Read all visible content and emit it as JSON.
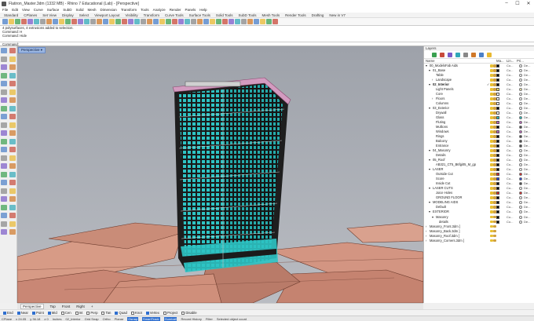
{
  "window": {
    "title": "Flatiron_Master.3dm (1332 MB) - Rhino 7 Educational (Lab) - [Perspective]",
    "controls": [
      "–",
      "☐",
      "✕"
    ]
  },
  "menubar": [
    "File",
    "Edit",
    "View",
    "Curve",
    "Surface",
    "SubD",
    "Solid",
    "Mesh",
    "Dimension",
    "Transform",
    "Tools",
    "Analyze",
    "Render",
    "Panels",
    "Help"
  ],
  "toolbar_tabs": [
    "Standard",
    "CPlanes",
    "Set View",
    "Display",
    "Select",
    "Viewport Layout",
    "Visibility",
    "Transform",
    "Curve Tools",
    "Surface Tools",
    "Solid Tools",
    "SubD Tools",
    "Mesh Tools",
    "Render Tools",
    "Drafting",
    "New in V7"
  ],
  "command_history": [
    "4 polysurfaces, 4 extrusions added to selection.",
    "Command: H",
    "Command: Hide"
  ],
  "command_prompt": "Command:",
  "viewport": {
    "label": "Perspective ▾"
  },
  "viewport_tabs": [
    "Perspective",
    "Top",
    "Front",
    "Right",
    "+"
  ],
  "layers_panel": {
    "header": "Layers",
    "columns": [
      "Name",
      "Ma...",
      "Lin...",
      "Pri..."
    ],
    "rows": [
      {
        "name": "00_ModelsFab Aids",
        "indent": 0,
        "expand": "▾",
        "color": "#000000",
        "mat": "Co...",
        "pri": "De...",
        "mat_color": "#ffffff"
      },
      {
        "name": "01_Base",
        "indent": 1,
        "expand": "▾",
        "color": "#000000",
        "mat": "Co...",
        "pri": "De...",
        "mat_color": "#ffffff"
      },
      {
        "name": "Table",
        "indent": 2,
        "expand": "",
        "color": "#000000",
        "mat": "Co...",
        "pri": "De...",
        "mat_color": "#ffffff"
      },
      {
        "name": "Landscape",
        "indent": 2,
        "expand": "›",
        "color": "#000000",
        "mat": "Co...",
        "pri": "De...",
        "mat_color": "#ffffff"
      },
      {
        "name": "02_Interior",
        "indent": 1,
        "expand": "▾",
        "color": "#000000",
        "mat": "Co...",
        "pri": "De...",
        "mat_color": "#ffffff",
        "check": "✓",
        "bold": true
      },
      {
        "name": "Light Panels",
        "indent": 2,
        "expand": "",
        "color": "#f0e060",
        "mat": "Co...",
        "pri": "De...",
        "mat_color": "#f7efb0"
      },
      {
        "name": "Core",
        "indent": 2,
        "expand": "",
        "color": "#ffffff",
        "mat": "Co...",
        "pri": "De...",
        "mat_color": "#ffffff"
      },
      {
        "name": "Floors",
        "indent": 2,
        "expand": "›",
        "color": "#ffffff",
        "mat": "Co...",
        "pri": "De...",
        "mat_color": "#ffffff"
      },
      {
        "name": "Columns",
        "indent": 2,
        "expand": "",
        "color": "#ffffff",
        "mat": "Co...",
        "pri": "De...",
        "mat_color": "#ffffff"
      },
      {
        "name": "03_Exterior",
        "indent": 1,
        "expand": "▾",
        "color": "#000000",
        "mat": "Co...",
        "pri": "De...",
        "mat_color": "#ffffff"
      },
      {
        "name": "Drywall",
        "indent": 2,
        "expand": "",
        "color": "#ffffff",
        "mat": "Co...",
        "pri": "De...",
        "mat_color": "#ffffff"
      },
      {
        "name": "Glass",
        "indent": 2,
        "expand": "",
        "color": "#20c0c0",
        "mat": "Co...",
        "pri": "De...",
        "mat_color": "#20c0c0"
      },
      {
        "name": "Fluting",
        "indent": 2,
        "expand": "",
        "color": "#c060c0",
        "mat": "Co...",
        "pri": "De...",
        "mat_color": "#c060c0"
      },
      {
        "name": "Mullions",
        "indent": 2,
        "expand": "",
        "color": "#000000",
        "mat": "Co...",
        "pri": "De...",
        "mat_color": "#444444"
      },
      {
        "name": "Windows",
        "indent": 2,
        "expand": "",
        "color": "#c060c0",
        "mat": "Co...",
        "pri": "De...",
        "mat_color": "#c060c0"
      },
      {
        "name": "Rings",
        "indent": 2,
        "expand": "",
        "color": "#000000",
        "mat": "Co...",
        "pri": "De...",
        "mat_color": "#444444"
      },
      {
        "name": "Balcony",
        "indent": 2,
        "expand": "",
        "color": "#000000",
        "mat": "Co...",
        "pri": "De...",
        "mat_color": "#444444"
      },
      {
        "name": "Entrance",
        "indent": 2,
        "expand": "",
        "color": "#000000",
        "mat": "Co...",
        "pri": "De...",
        "mat_color": "#444444"
      },
      {
        "name": "04_Masonry",
        "indent": 1,
        "expand": "▾",
        "color": "#000000",
        "mat": "Co...",
        "pri": "De...",
        "mat_color": "#ffffff"
      },
      {
        "name": "Details",
        "indent": 2,
        "expand": "",
        "color": "#000000",
        "mat": "Co...",
        "pri": "De...",
        "mat_color": "#ffffff"
      },
      {
        "name": "05_Roof",
        "indent": 1,
        "expand": "▾",
        "color": "#000000",
        "mat": "Co...",
        "pri": "De...",
        "mat_color": "#ffffff"
      },
      {
        "name": "AB321_CT5_B6fgi05_M_gp",
        "indent": 2,
        "expand": "",
        "color": "#000000",
        "mat": "Co...",
        "pri": "De...",
        "mat_color": "#ffffff"
      },
      {
        "name": "LASER",
        "indent": 1,
        "expand": "▾",
        "color": "#000000",
        "mat": "Co...",
        "pri": "De...",
        "mat_color": "#ffffff"
      },
      {
        "name": "Outside Cut",
        "indent": 2,
        "expand": "",
        "color": "#e02020",
        "mat": "Co...",
        "pri": "De...",
        "mat_color": "#e02020"
      },
      {
        "name": "Score",
        "indent": 2,
        "expand": "",
        "color": "#2040e0",
        "mat": "Co...",
        "pri": "De...",
        "mat_color": "#2040e0"
      },
      {
        "name": "Inside Cut",
        "indent": 2,
        "expand": "",
        "color": "#000000",
        "mat": "Co...",
        "pri": "De...",
        "mat_color": "#444444"
      },
      {
        "name": "LASER CUTS",
        "indent": 1,
        "expand": "▾",
        "color": "#000000",
        "mat": "Co...",
        "pri": "De...",
        "mat_color": "#ffffff"
      },
      {
        "name": "Joice Holes",
        "indent": 2,
        "expand": "",
        "color": "#e02020",
        "mat": "Co...",
        "pri": "De...",
        "mat_color": "#e02020"
      },
      {
        "name": "GROUND FLOOR",
        "indent": 2,
        "expand": "",
        "color": "#000000",
        "mat": "Co...",
        "pri": "De...",
        "mat_color": "#ffffff"
      },
      {
        "name": "MODELING AIDS",
        "indent": 1,
        "expand": "▾",
        "color": "#000000",
        "mat": "Co...",
        "pri": "De...",
        "mat_color": "#ffffff"
      },
      {
        "name": "Default",
        "indent": 2,
        "expand": "",
        "color": "#000000",
        "mat": "Co...",
        "pri": "De...",
        "mat_color": "#ffffff"
      },
      {
        "name": "EXTERIOR",
        "indent": 1,
        "expand": "▾",
        "color": "#000000",
        "mat": "Co...",
        "pri": "De...",
        "mat_color": "#ffffff"
      },
      {
        "name": "Masonry",
        "indent": 2,
        "expand": "▾",
        "color": "#000000",
        "mat": "Co...",
        "pri": "De...",
        "mat_color": "#ffffff"
      },
      {
        "name": "details",
        "indent": 3,
        "expand": "",
        "color": "#000000",
        "mat": "Co...",
        "pri": "De...",
        "mat_color": "#ffffff"
      },
      {
        "name": "Masonry_Front.3dm ]",
        "indent": 0,
        "expand": "›",
        "color": "",
        "mat": "",
        "pri": "",
        "mat_color": ""
      },
      {
        "name": "Masonry_Back.3dm ]",
        "indent": 0,
        "expand": "›",
        "color": "",
        "mat": "",
        "pri": "",
        "mat_color": ""
      },
      {
        "name": "Masonry_Roof.3dm ]",
        "indent": 0,
        "expand": "›",
        "color": "",
        "mat": "",
        "pri": "",
        "mat_color": ""
      },
      {
        "name": "Masonry_Corners.3dm ]",
        "indent": 0,
        "expand": "›",
        "color": "",
        "mat": "",
        "pri": "",
        "mat_color": ""
      }
    ]
  },
  "osnaps": [
    {
      "label": "End",
      "on": true
    },
    {
      "label": "Near",
      "on": true
    },
    {
      "label": "Point",
      "on": true
    },
    {
      "label": "Mid",
      "on": true
    },
    {
      "label": "Cen",
      "on": false
    },
    {
      "label": "Int",
      "on": false
    },
    {
      "label": "Perp",
      "on": false
    },
    {
      "label": "Tan",
      "on": false
    },
    {
      "label": "Quad",
      "on": true
    },
    {
      "label": "Knot",
      "on": false
    },
    {
      "label": "Vertex",
      "on": true
    },
    {
      "label": "Project",
      "on": false
    },
    {
      "label": "Disable",
      "on": false
    }
  ],
  "status": {
    "cplane": "CPlane",
    "x": "x 24.05",
    "y": "y 36.18",
    "z": "z 0",
    "units": "Inches",
    "layer": "02_Interior",
    "toggles": [
      "Grid Snap",
      "Ortho",
      "Planar"
    ],
    "active": [
      "Osnap",
      "SmartTrack",
      "Gumball"
    ],
    "tail": [
      "Record History",
      "Filter",
      "Selected object count"
    ]
  },
  "icon_colors": [
    "#4a7fc8",
    "#e8b830",
    "#3aa050",
    "#c84a3a",
    "#7a5ac8",
    "#30a8b8",
    "#888888",
    "#d07828"
  ]
}
